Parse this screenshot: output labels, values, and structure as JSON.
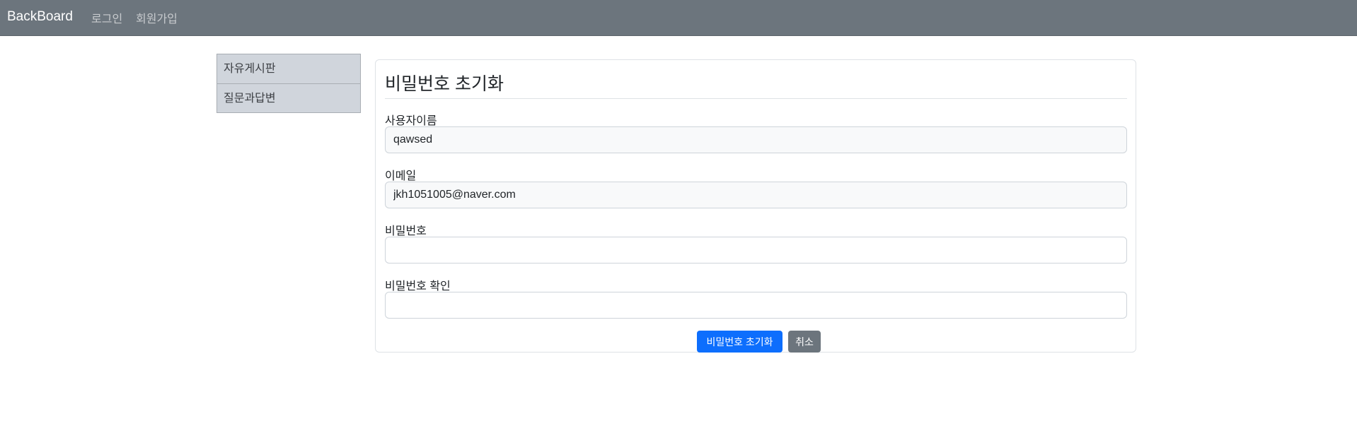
{
  "navbar": {
    "brand": "BackBoard",
    "links": [
      {
        "label": "로그인"
      },
      {
        "label": "회원가입"
      }
    ],
    "bg_color": "#6c757d"
  },
  "sidebar": {
    "items": [
      {
        "label": "자유게시판"
      },
      {
        "label": "질문과답변"
      }
    ]
  },
  "form": {
    "title": "비밀번호 초기화",
    "fields": [
      {
        "label": "사용자이름",
        "value": "qawsed",
        "readonly": true
      },
      {
        "label": "이메일",
        "value": "jkh1051005@naver.com",
        "readonly": true
      },
      {
        "label": "비밀번호",
        "value": "",
        "readonly": false
      },
      {
        "label": "비밀번호 확인",
        "value": "",
        "readonly": false
      }
    ],
    "submit_label": "비밀번호 초기화",
    "cancel_label": "취소",
    "submit_color": "#0d6efd",
    "cancel_color": "#6c757d"
  }
}
